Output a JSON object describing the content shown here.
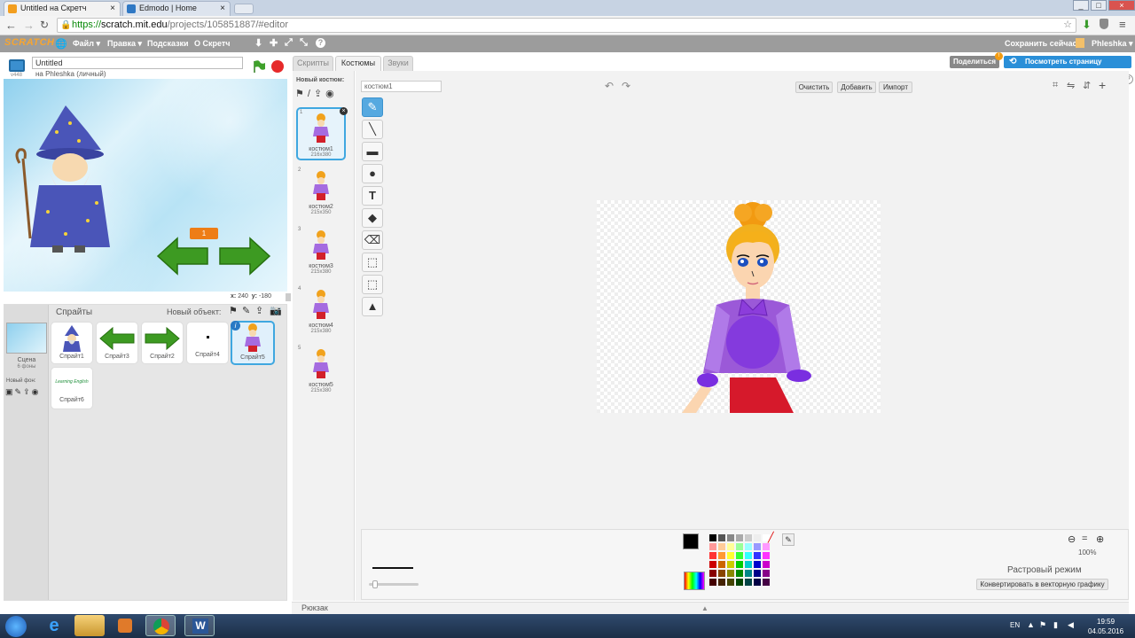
{
  "browser": {
    "tabs": [
      {
        "label": "Untitled на Скретч",
        "active": true
      },
      {
        "label": "Edmodo | Home",
        "active": false
      }
    ],
    "url": {
      "scheme": "https://",
      "host": "scratch.mit.edu",
      "path": "/projects/105851887/#editor"
    },
    "window_controls": [
      "_",
      "□",
      "×"
    ]
  },
  "menubar": {
    "logo": "SCRATCH",
    "items": [
      "Файл ▾",
      "Правка ▾",
      "Подсказки",
      "О Скретч"
    ],
    "save_now": "Сохранить сейчас",
    "user": "Phleshka ▾"
  },
  "project": {
    "title": "Untitled",
    "author": "на Phleshka (личный)",
    "version": "v448"
  },
  "stage": {
    "variable_value": "1",
    "coords": {
      "x_label": "x:",
      "x": "240",
      "y_label": "y:",
      "y": "-180"
    }
  },
  "sprites_pane": {
    "title": "Спрайты",
    "new_object_label": "Новый объект:",
    "scene_label": "Сцена",
    "scene_sub": "6 фоны",
    "new_backdrop_label": "Новый фон:",
    "sprites": [
      {
        "name": "Спрайт1",
        "icon": "wizard"
      },
      {
        "name": "Спрайт3",
        "icon": "arrow-left"
      },
      {
        "name": "Спрайт2",
        "icon": "arrow-right"
      },
      {
        "name": "Спрайт4",
        "icon": "dot"
      },
      {
        "name": "Спрайт5",
        "icon": "girl",
        "selected": true
      },
      {
        "name": "Спрайт6",
        "icon": "text",
        "text": "Learning English"
      }
    ]
  },
  "tabs": {
    "scripts": "Скрипты",
    "costumes": "Костюмы",
    "sounds": "Звуки"
  },
  "share": {
    "share_label": "Поделиться",
    "see_page_label": "Посмотреть страницу проекта"
  },
  "costumes": {
    "new_costume_label": "Новый костюм:",
    "list": [
      {
        "num": "1",
        "name": "костюм1",
        "size": "216x380",
        "selected": true
      },
      {
        "num": "2",
        "name": "костюм2",
        "size": "215x350"
      },
      {
        "num": "3",
        "name": "костюм3",
        "size": "215x380"
      },
      {
        "num": "4",
        "name": "костюм4",
        "size": "215x380"
      },
      {
        "num": "5",
        "name": "костюм5",
        "size": "215x380"
      }
    ]
  },
  "editor": {
    "costume_name": "костюм1",
    "clear": "Очистить",
    "add": "Добавить",
    "import": "Импорт",
    "zoom": "100%",
    "mode": "Растровый режим",
    "convert": "Конвертировать в векторную графику"
  },
  "backpack": {
    "label": "Рюкзак"
  },
  "taskbar": {
    "lang": "EN",
    "time": "19:59",
    "date": "04.05.2016"
  }
}
